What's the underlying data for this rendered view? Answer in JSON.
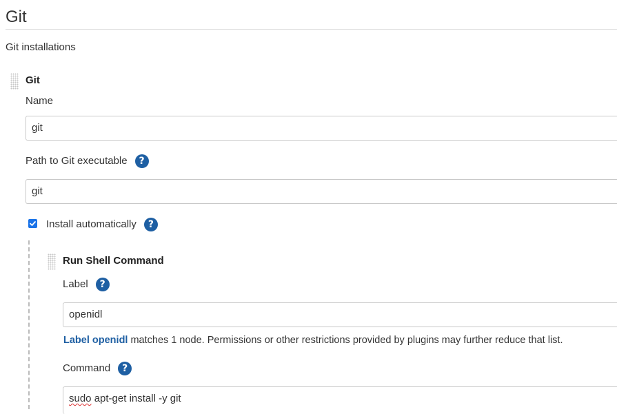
{
  "section": {
    "title": "Git",
    "installations_label": "Git installations"
  },
  "git_installation": {
    "title": "Git",
    "name_label": "Name",
    "name_value": "git",
    "path_label": "Path to Git executable",
    "path_value": "git",
    "install_auto_label": "Install automatically",
    "install_auto_checked": true
  },
  "installer": {
    "title": "Run Shell Command",
    "label_label": "Label",
    "label_value": "openidl",
    "label_note_link": "Label openidl",
    "label_note_rest": " matches 1 node. Permissions or other restrictions provided by plugins may further reduce that list.",
    "command_label": "Command",
    "command_first_word": "sudo",
    "command_rest": " apt-get install -y git"
  },
  "help_icon_glyph": "?",
  "colors": {
    "help_icon": "#1e5fa3",
    "link": "#1e5fa3",
    "checkbox": "#1a73e8"
  }
}
